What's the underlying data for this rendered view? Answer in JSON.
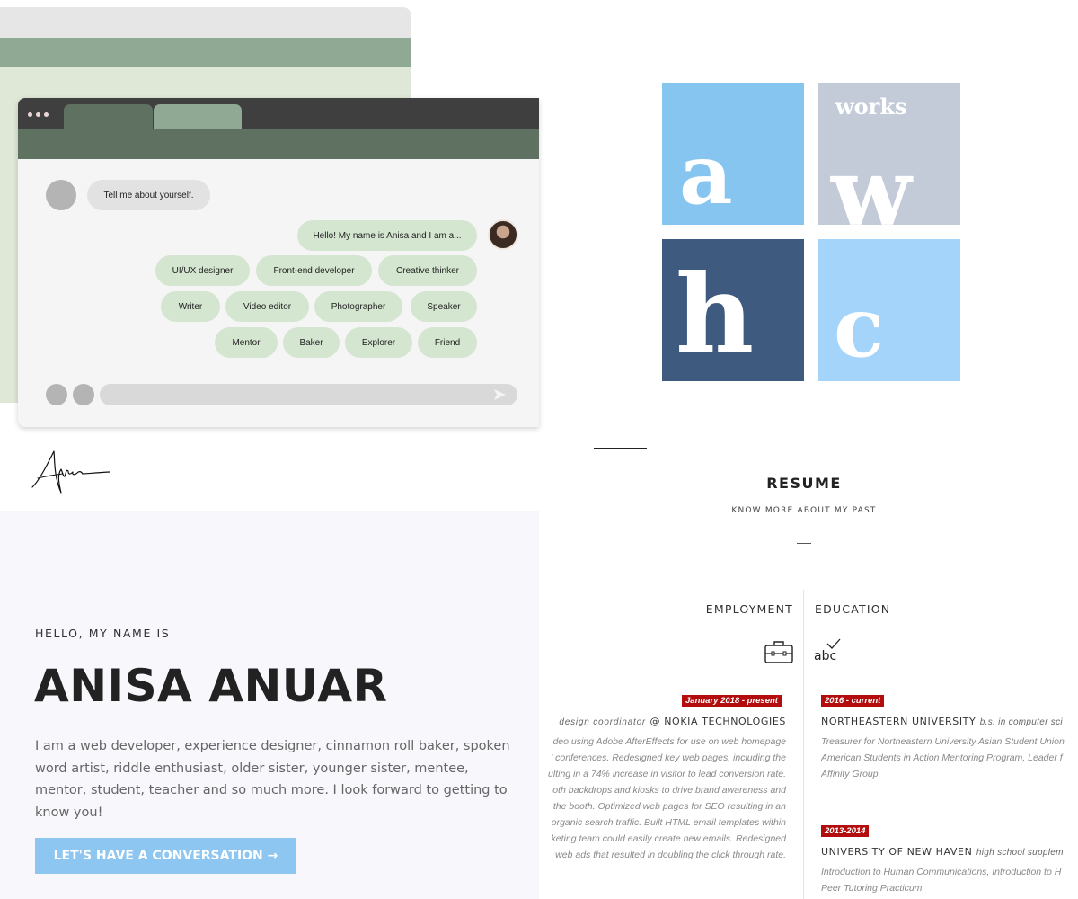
{
  "chat": {
    "bot_question": "Tell me about yourself.",
    "user_reply": "Hello! My name is Anisa and I am a...",
    "tags": [
      "UI/UX designer",
      "Front-end developer",
      "Creative thinker",
      "Writer",
      "Video editor",
      "Photographer",
      "Speaker",
      "Mentor",
      "Baker",
      "Explorer",
      "Friend"
    ]
  },
  "signature_text": "Anisa",
  "hero": {
    "hello": "HELLO, MY NAME IS",
    "name": "ANISA ANUAR",
    "bio": "I am a web developer, experience designer, cinnamon roll baker, spoken word artist, riddle enthusiast, older sister, younger sister, mentee, mentor, student, teacher and so much more. I look forward to getting to know you!",
    "cta": "LET'S HAVE A CONVERSATION →"
  },
  "logo": {
    "tiles": [
      {
        "letter": "a",
        "color": "#85c5f0"
      },
      {
        "letter": "w",
        "color": "#c3cad8",
        "caption": "works"
      },
      {
        "letter": "h",
        "color": "#3e5a7f"
      },
      {
        "letter": "c",
        "color": "#a5d4fa"
      }
    ]
  },
  "resume": {
    "title": "RESUME",
    "subtitle": "KNOW MORE ABOUT MY PAST",
    "employment": {
      "heading": "EMPLOYMENT",
      "icon": "briefcase-icon",
      "date": "January 2018 - present",
      "role": "design coordinator",
      "org": "@ NOKIA TECHNOLOGIES",
      "lines": [
        "deo using Adobe AfterEffects for use on web homepage",
        "' conferences. Redesigned key web pages, including the",
        "ulting in a 74% increase in visitor to lead conversion rate.",
        "oth backdrops and kiosks to drive brand awareness and",
        "the booth. Optimized web pages for SEO resulting in an",
        "organic search traffic. Built HTML email templates within",
        "keting team could easily create new emails. Redesigned",
        "web ads that resulted in doubling the click through rate."
      ]
    },
    "education": {
      "heading": "EDUCATION",
      "icon": "abc-check-icon",
      "icon_text": "abc",
      "entries": [
        {
          "date": "2016 - current",
          "org": "NORTHEASTERN UNIVERSITY",
          "degree": "b.s. in computer sci",
          "lines": [
            "Treasurer for Northeastern University Asian Student Union",
            "American Students in Action Mentoring Program, Leader f",
            "Affinity Group."
          ]
        },
        {
          "date": "2013-2014",
          "org": "UNIVERSITY OF NEW HAVEN",
          "degree": "high school supplem",
          "lines": [
            "Introduction to Human Communications, Introduction to H",
            "Peer Tutoring Practicum."
          ]
        }
      ]
    }
  }
}
